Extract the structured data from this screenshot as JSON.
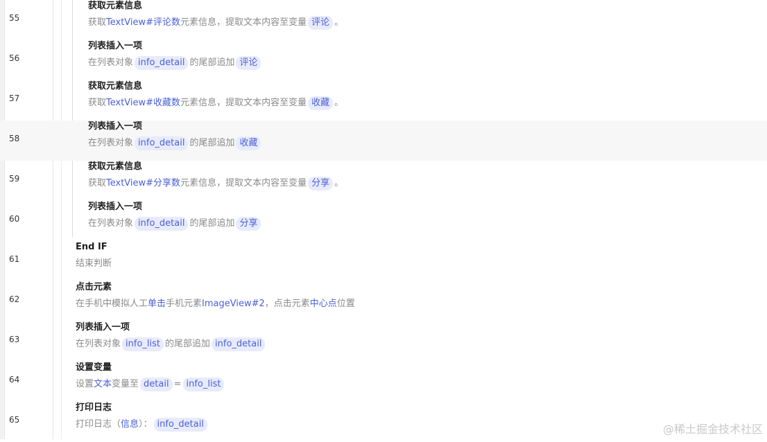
{
  "rows": [
    {
      "no": "55",
      "title": "获取元素信息",
      "a": "获取",
      "b": "TextView#评论数",
      "c": "元素信息，提取文本内容至变量",
      "d": "评论",
      "e": "。"
    },
    {
      "no": "56",
      "title": "列表插入一项",
      "a": "在列表对象",
      "b": "info_detail",
      "c": "的尾部追加",
      "d": "评论"
    },
    {
      "no": "57",
      "title": "获取元素信息",
      "a": "获取",
      "b": "TextView#收藏数",
      "c": "元素信息，提取文本内容至变量",
      "d": "收藏",
      "e": "。"
    },
    {
      "no": "58",
      "title": "列表插入一项",
      "a": "在列表对象",
      "b": "info_detail",
      "c": "的尾部追加",
      "d": "收藏"
    },
    {
      "no": "59",
      "title": "获取元素信息",
      "a": "获取",
      "b": "TextView#分享数",
      "c": "元素信息，提取文本内容至变量",
      "d": "分享",
      "e": "。"
    },
    {
      "no": "60",
      "title": "列表插入一项",
      "a": "在列表对象",
      "b": "info_detail",
      "c": "的尾部追加",
      "d": "分享"
    },
    {
      "no": "61",
      "title": "End IF",
      "desc": "结束判断"
    },
    {
      "no": "62",
      "title": "点击元素",
      "a": "在手机中模拟人工",
      "b": "单击",
      "c": "手机元素",
      "d": "ImageView#2",
      "e": "，点击元素",
      "f": "中心点",
      "g": "位置"
    },
    {
      "no": "63",
      "title": "列表插入一项",
      "a": "在列表对象",
      "b": "info_list",
      "c": "的尾部追加",
      "d": "info_detail"
    },
    {
      "no": "64",
      "title": "设置变量",
      "a": "设置",
      "b": "文本",
      "c": "变量至",
      "d": "detail",
      "e": "=",
      "f": "info_list"
    },
    {
      "no": "65",
      "title": "打印日志",
      "a": "打印日志（",
      "b": "信息",
      "c": "）：",
      "d": "info_detail"
    }
  ],
  "watermark": "@稀土掘金技术社区"
}
